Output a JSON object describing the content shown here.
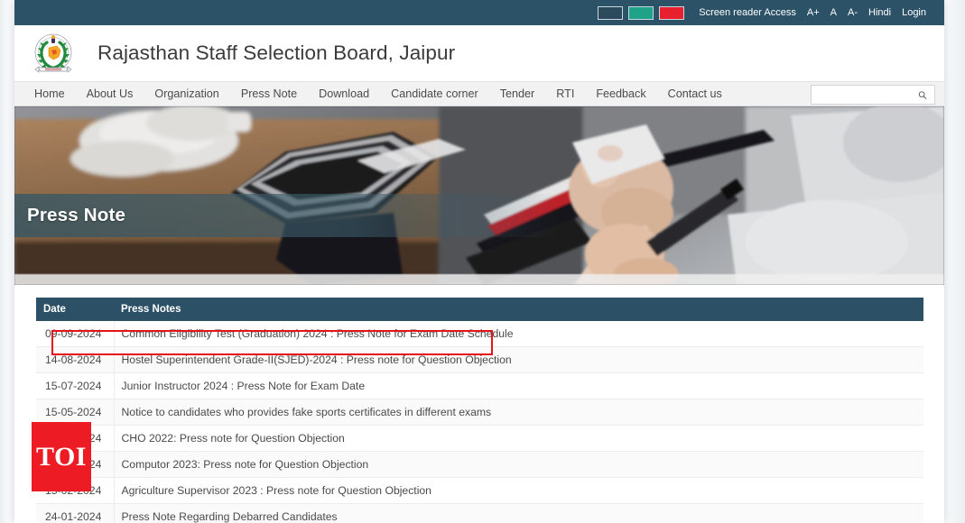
{
  "topbar": {
    "swatches": [
      {
        "name": "navy",
        "color": "#2b4a5c"
      },
      {
        "name": "teal",
        "color": "#1ea388"
      },
      {
        "name": "red",
        "color": "#e8202e"
      }
    ],
    "screen_reader": "Screen reader Access",
    "font_increase": "A+",
    "font_normal": "A",
    "font_decrease": "A-",
    "language": "Hindi",
    "login": "Login"
  },
  "header": {
    "title": "Rajasthan Staff Selection Board, Jaipur",
    "logo_name": "rajasthan-government-emblem"
  },
  "nav": {
    "items": [
      {
        "label": "Home"
      },
      {
        "label": "About Us"
      },
      {
        "label": "Organization"
      },
      {
        "label": "Press Note"
      },
      {
        "label": "Download"
      },
      {
        "label": "Candidate corner"
      },
      {
        "label": "Tender"
      },
      {
        "label": "RTI"
      },
      {
        "label": "Feedback"
      },
      {
        "label": "Contact us"
      }
    ]
  },
  "search": {
    "value": "",
    "placeholder": "",
    "icon": "search-icon"
  },
  "banner": {
    "caption": "Press Note"
  },
  "table": {
    "columns": [
      "Date",
      "Press Notes"
    ],
    "rows": [
      {
        "date": "09-09-2024",
        "note": "Common Eligibility Test (Graduation) 2024 : Press Note for Exam Date Schedule",
        "highlighted": true
      },
      {
        "date": "14-08-2024",
        "note": "Hostel Superintendent Grade-II(SJED)-2024 : Press note for Question Objection",
        "highlighted": false
      },
      {
        "date": "15-07-2024",
        "note": "Junior Instructor 2024 : Press Note for Exam Date",
        "highlighted": false
      },
      {
        "date": "15-05-2024",
        "note": "Notice to candidates who provides fake sports certificates in different exams",
        "highlighted": false
      },
      {
        "date": "15-04-2024",
        "note": "CHO 2022: Press note for Question Objection",
        "highlighted": false
      },
      {
        "date": "15-03-2024",
        "note": "Computor 2023: Press note for Question Objection",
        "highlighted": false
      },
      {
        "date": "15-02-2024",
        "note": "Agriculture Supervisor 2023 : Press note for Question Objection",
        "highlighted": false
      },
      {
        "date": "24-01-2024",
        "note": "Press Note Regarding Debarred Candidates",
        "highlighted": false
      }
    ]
  },
  "watermark": {
    "text": "TOI",
    "color": "#ed1c24"
  }
}
